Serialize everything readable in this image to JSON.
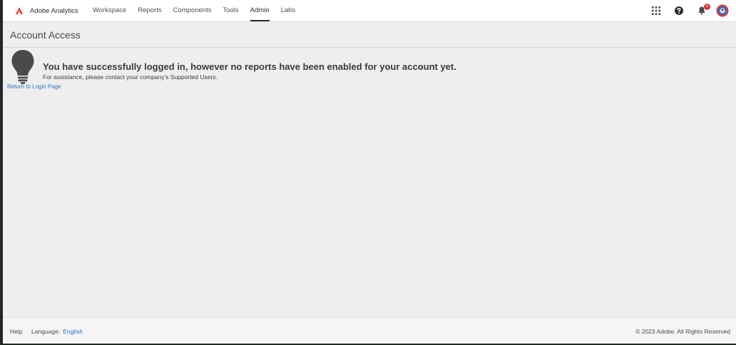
{
  "app": {
    "brand_name": "Adobe Analytics",
    "logo_color": "#eb1000"
  },
  "nav": {
    "items": [
      {
        "label": "Workspace",
        "active": false
      },
      {
        "label": "Reports",
        "active": false
      },
      {
        "label": "Components",
        "active": false
      },
      {
        "label": "Tools",
        "active": false
      },
      {
        "label": "Admin",
        "active": true
      },
      {
        "label": "Labs",
        "active": false
      }
    ]
  },
  "top_icons": {
    "apps": "apps-grid-icon",
    "help": "help-icon",
    "notifications": "bell-icon",
    "notifications_count": "1",
    "avatar": "avatar-icon"
  },
  "page": {
    "title": "Account Access"
  },
  "message": {
    "icon": "lightbulb-icon",
    "heading": "You have successfully logged in, however no reports have been enabled for your account yet.",
    "sub": "For assistance, please contact your company's Supported Users.",
    "return_link": "Return to Login Page"
  },
  "footer": {
    "help_label": "Help",
    "language_label": "Language:",
    "language_value": "English",
    "copyright": "© 2023 Adobe. All Rights Reserved"
  },
  "colors": {
    "link": "#2d6fc4",
    "badge": "#d7373f",
    "background": "#eeeeee"
  }
}
